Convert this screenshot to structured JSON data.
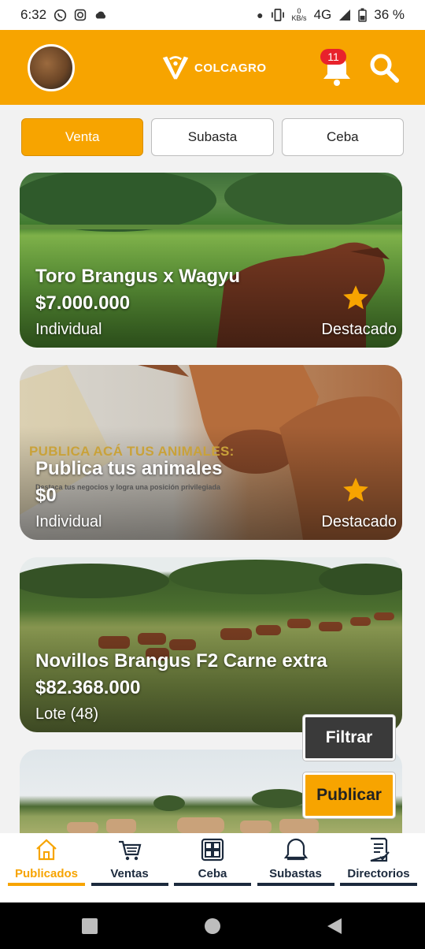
{
  "status_bar": {
    "time": "6:32",
    "notification_icons": [
      "whatsapp-icon",
      "instagram-icon",
      "cloud-icon"
    ],
    "network": "4G",
    "battery": "36 %",
    "status_icons": [
      "dot-icon",
      "vibrate-icon",
      "data-speed-icon",
      "signal-icon",
      "battery-icon"
    ],
    "data_speed": "0 KB/s"
  },
  "header": {
    "brand": "COLCAGRO",
    "notification_count": "11",
    "colors": {
      "primary": "#f7a400",
      "badge": "#e8222c",
      "dark": "#1c2a3d"
    }
  },
  "filters": {
    "selected": "Venta",
    "tabs": [
      {
        "label": "Venta"
      },
      {
        "label": "Subasta"
      },
      {
        "label": "Ceba"
      }
    ]
  },
  "listings": [
    {
      "title": "Toro Brangus x Wagyu",
      "price": "$7.000.000",
      "kind": "Individual",
      "badge": "Destacado",
      "featured": true
    },
    {
      "title": "Publica tus animales",
      "price": "$0",
      "kind": "Individual",
      "badge": "Destacado",
      "featured": true,
      "promo_heading": "PUBLICA ACÁ TUS ANIMALES:",
      "promo_sub": "Destaca tus negocios y logra una posición privilegiada"
    },
    {
      "title": "Novillos Brangus F2 Carne extra",
      "price": "$82.368.000",
      "kind": "Lote (48)",
      "featured": false
    }
  ],
  "actions": {
    "filter_label": "Filtrar",
    "publish_label": "Publicar"
  },
  "bottom_nav": {
    "active": "Publicados",
    "items": [
      {
        "label": "Publicados",
        "icon": "home-icon"
      },
      {
        "label": "Ventas",
        "icon": "cart-icon"
      },
      {
        "label": "Ceba",
        "icon": "grid-icon"
      },
      {
        "label": "Subastas",
        "icon": "bell-icon"
      },
      {
        "label": "Directorios",
        "icon": "checklist-icon"
      }
    ]
  }
}
